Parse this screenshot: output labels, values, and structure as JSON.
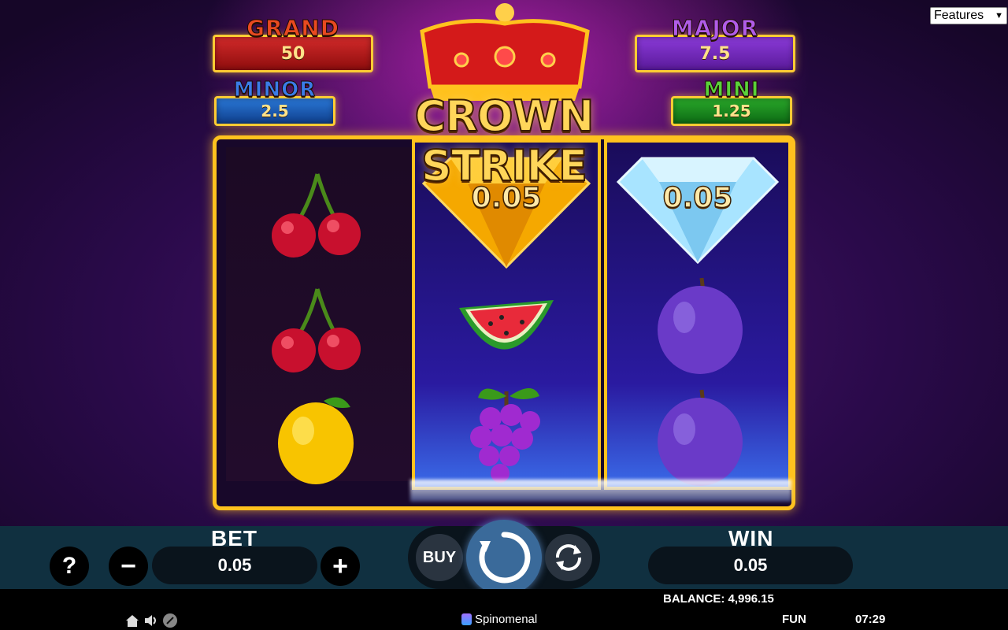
{
  "features_dropdown": {
    "selected": "Features"
  },
  "jackpots": {
    "grand": {
      "label": "GRAND",
      "value": "50"
    },
    "major": {
      "label": "MAJOR",
      "value": "7.5"
    },
    "minor": {
      "label": "MINOR",
      "value": "2.5"
    },
    "mini": {
      "label": "MINI",
      "value": "1.25"
    }
  },
  "logo": {
    "text": "CROWN STRIKE"
  },
  "reels": [
    {
      "symbols": [
        "cherry",
        "cherry",
        "lemon"
      ]
    },
    {
      "symbols": [
        "gold-diamond",
        "watermelon",
        "grapes"
      ],
      "coin_value": "0.05"
    },
    {
      "symbols": [
        "blue-diamond",
        "plum",
        "plum"
      ],
      "coin_value": "0.05"
    }
  ],
  "controls": {
    "help_label": "?",
    "bet_label": "BET",
    "bet_value": "0.05",
    "minus_label": "−",
    "plus_label": "+",
    "buy_label": "BUY",
    "win_label": "WIN",
    "win_value": "0.05"
  },
  "status": {
    "balance_label": "BALANCE:",
    "balance_value": "4,996.15",
    "provider": "Spinomenal",
    "mode": "FUN",
    "time": "07:29"
  },
  "colors": {
    "frame_gold": "#ffc21e",
    "control_bar": "#103040",
    "grand": "#d22a2a",
    "major": "#8a3ad8",
    "minor": "#2a78d8",
    "mini": "#2aa82a"
  }
}
